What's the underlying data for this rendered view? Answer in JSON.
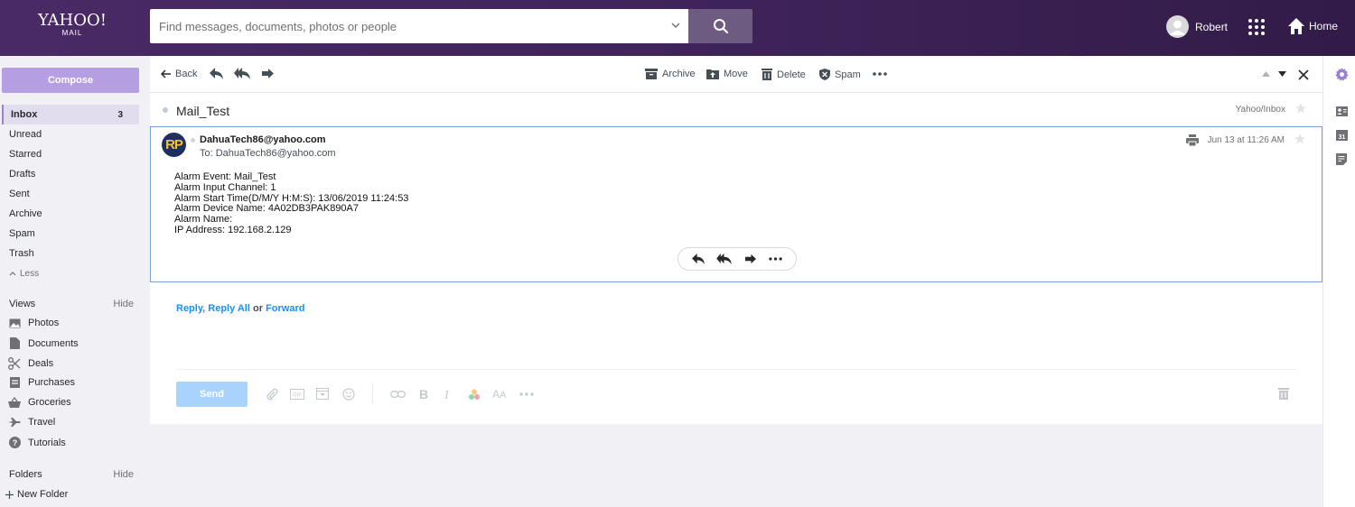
{
  "header": {
    "logo_line1": "YAHOO!",
    "logo_line2": "MAIL",
    "search_placeholder": "Find messages, documents, photos or people",
    "user_name": "Robert",
    "home_label": "Home",
    "icons": [
      "search-icon",
      "chevron-down-icon",
      "user-avatar-icon",
      "apps-grid-icon",
      "home-icon"
    ]
  },
  "sidebar": {
    "compose_label": "Compose",
    "inbox": {
      "label": "Inbox",
      "count": "3"
    },
    "folders": [
      "Unread",
      "Starred",
      "Drafts",
      "Sent",
      "Archive",
      "Spam",
      "Trash"
    ],
    "less_label": "Less",
    "views_title": "Views",
    "views_hide": "Hide",
    "views": [
      {
        "label": "Photos",
        "icon": "photos-icon"
      },
      {
        "label": "Documents",
        "icon": "document-icon"
      },
      {
        "label": "Deals",
        "icon": "scissors-icon"
      },
      {
        "label": "Purchases",
        "icon": "receipt-icon"
      },
      {
        "label": "Groceries",
        "icon": "basket-icon"
      },
      {
        "label": "Travel",
        "icon": "plane-icon"
      },
      {
        "label": "Tutorials",
        "icon": "help-icon"
      }
    ],
    "folders_title": "Folders",
    "folders_hide": "Hide",
    "new_folder_label": "New Folder"
  },
  "toolbar": {
    "back": "Back",
    "archive": "Archive",
    "move": "Move",
    "delete": "Delete",
    "spam": "Spam"
  },
  "message": {
    "subject": "Mail_Test",
    "folder_path": "Yahoo/Inbox",
    "avatar_initials": "RP",
    "from": "DahuaTech86@yahoo.com",
    "to": "To: DahuaTech86@yahoo.com",
    "date": "Jun 13 at 11:26 AM",
    "body_lines": [
      "Alarm Event: Mail_Test",
      "Alarm Input Channel: 1",
      "Alarm Start Time(D/M/Y H:M:S): 13/06/2019 11:24:53",
      "Alarm Device Name: 4A02DB3PAK890A7",
      "Alarm Name:",
      "IP Address: 192.168.2.129"
    ]
  },
  "composer": {
    "reply": "Reply",
    "reply_all": "Reply All",
    "or": "or",
    "forward": "Forward",
    "send_label": "Send"
  },
  "colors": {
    "header_bg": "#3d2257",
    "compose_bg": "#b59fe2",
    "link": "#188fff",
    "send_bg": "#a9d3fc",
    "selected_border": "#7b9ee0"
  }
}
